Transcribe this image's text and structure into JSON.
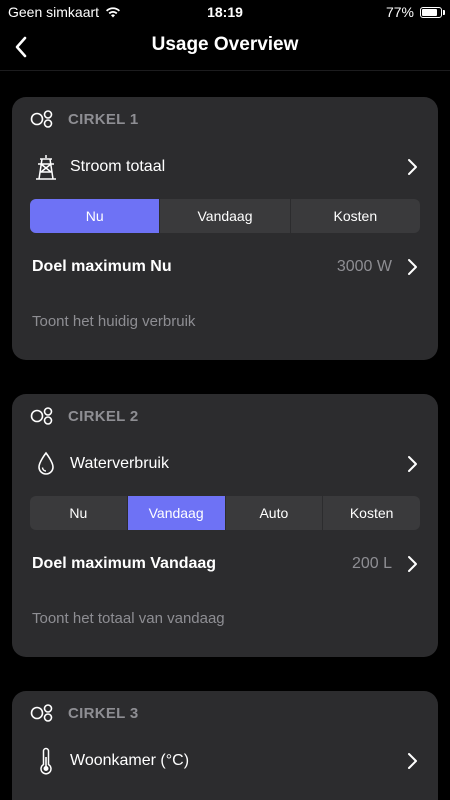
{
  "status": {
    "carrier": "Geen simkaart",
    "time": "18:19",
    "battery": "77%"
  },
  "nav": {
    "title": "Usage Overview"
  },
  "cards": [
    {
      "label": "CIRKEL 1",
      "source": "Stroom totaal",
      "segments": [
        "Nu",
        "Vandaag",
        "Kosten"
      ],
      "goal_label": "Doel maximum Nu",
      "goal_value": "3000 W",
      "description": "Toont het huidig verbruik"
    },
    {
      "label": "CIRKEL 2",
      "source": "Waterverbruik",
      "segments": [
        "Nu",
        "Vandaag",
        "Auto",
        "Kosten"
      ],
      "goal_label": "Doel maximum Vandaag",
      "goal_value": "200 L",
      "description": "Toont het totaal van vandaag"
    },
    {
      "label": "CIRKEL 3",
      "source": "Woonkamer (°C)"
    }
  ],
  "colors": {
    "accent": "#6e72f5",
    "card": "#2c2c2e",
    "background": "#000000",
    "secondary_text": "#8e8e93"
  }
}
